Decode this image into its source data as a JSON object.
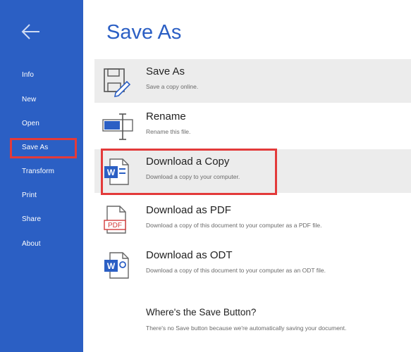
{
  "sidebar": {
    "back_icon": "arrow-left-icon",
    "items": [
      {
        "label": "Info"
      },
      {
        "label": "New"
      },
      {
        "label": "Open"
      },
      {
        "label": "Save As"
      },
      {
        "label": "Transform"
      },
      {
        "label": "Print"
      },
      {
        "label": "Share"
      },
      {
        "label": "About"
      }
    ],
    "selected": "Save As"
  },
  "main": {
    "title": "Save As",
    "options": [
      {
        "title": "Save As",
        "description": "Save a copy online.",
        "icon": "save-as-icon"
      },
      {
        "title": "Rename",
        "description": "Rename this file.",
        "icon": "rename-icon"
      },
      {
        "title": "Download a Copy",
        "description": "Download a copy to your computer.",
        "icon": "word-document-icon"
      },
      {
        "title": "Download as PDF",
        "description": "Download a copy of this document to your computer as a PDF file.",
        "icon": "pdf-icon",
        "icon_text": "PDF"
      },
      {
        "title": "Download as ODT",
        "description": "Download a copy of this document to your computer as an ODT file.",
        "icon": "odt-icon"
      }
    ],
    "help": {
      "title": "Where's the Save Button?",
      "description": "There's no Save button because we're automatically saving your document."
    }
  },
  "colors": {
    "sidebar": "#2b5fc4",
    "accent": "#2b5fc4",
    "highlight_border": "#e33a3a",
    "shaded_row": "#ececec"
  }
}
